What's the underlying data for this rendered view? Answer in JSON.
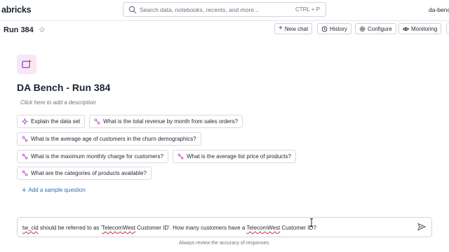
{
  "header": {
    "brand": "abricks",
    "search_placeholder": "Search data, notebooks, recents, and more...",
    "search_shortcut": "CTRL + P",
    "workspace": "da-benc"
  },
  "run": {
    "title": "Run 384",
    "buttons": {
      "new_chat": "New chat",
      "history": "History",
      "configure": "Configure",
      "monitoring": "Monitoring"
    }
  },
  "space": {
    "title": "DA Bench - Run 384",
    "description_placeholder": "Click here to add a description"
  },
  "samples": {
    "explain": "Explain the data set",
    "q1": "What is the total revenue by month from sales orders?",
    "q2": "What is the average age of customers in the churn demographics?",
    "q3": "What is the maximum monthly charge for customers?",
    "q4": "What is the average list price of products?",
    "q5": "What are the categories of products available?",
    "add_label": "Add a sample question"
  },
  "chat": {
    "p1": "tw_cid",
    "p2": " should be referred to as '",
    "p3": "TelecomWest",
    "p4": " Customer ID'. How many customers have a ",
    "p5": "TelecomWest",
    "p6": " Customer ID?",
    "footer": "Always review the accuracy of responses."
  },
  "colors": {
    "accent_link": "#2a6ebb",
    "sparkle_purple": "#9b3fd6",
    "sparkle_pink": "#e0358a",
    "border": "#cfd4da"
  }
}
